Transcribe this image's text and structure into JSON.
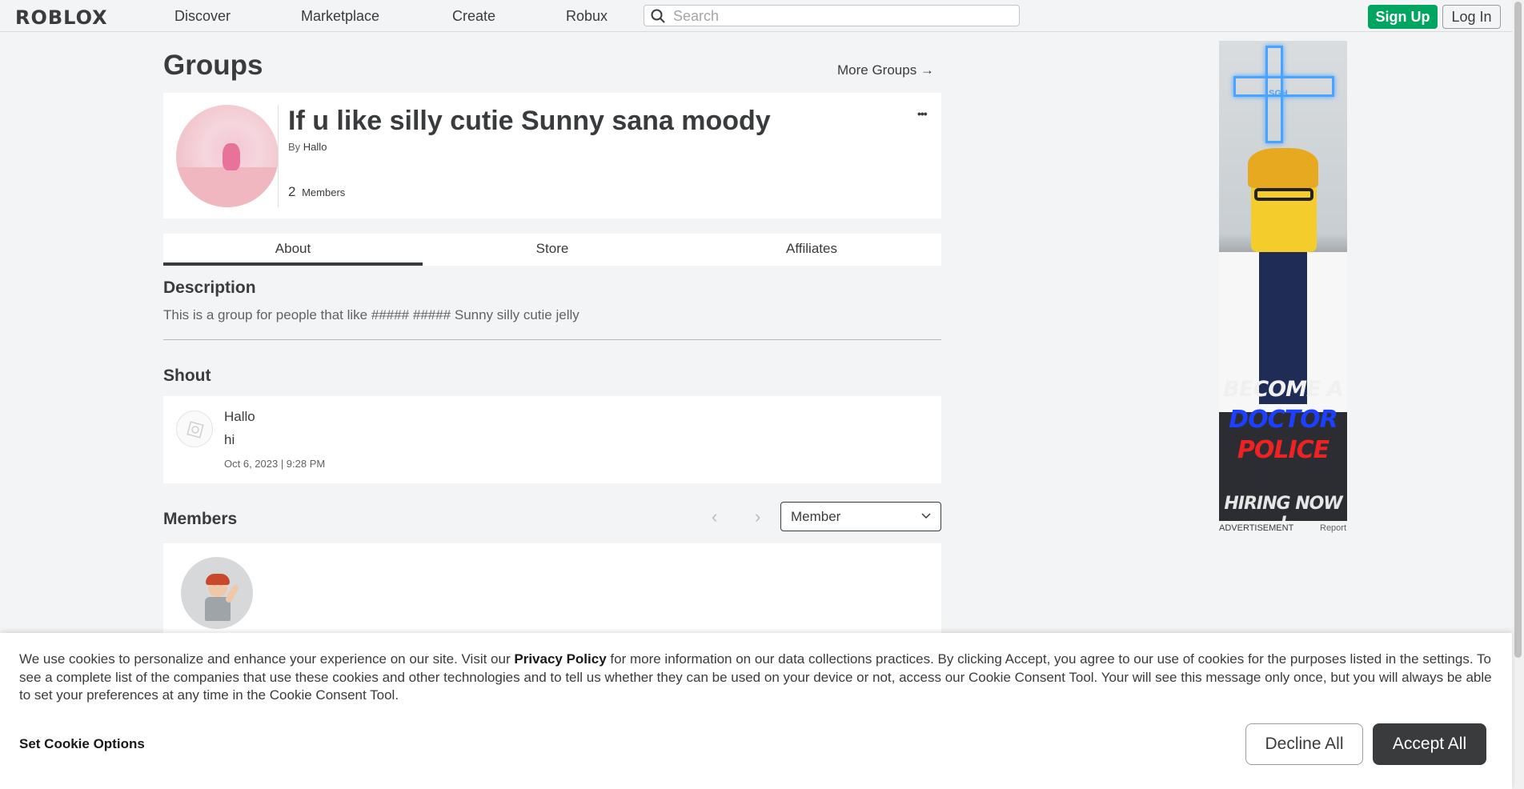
{
  "nav": {
    "logo": "ROBLOX",
    "links": [
      "Discover",
      "Marketplace",
      "Create",
      "Robux"
    ],
    "search_placeholder": "Search",
    "signup_label": "Sign Up",
    "login_label": "Log In"
  },
  "page": {
    "title": "Groups",
    "more_groups": "More Groups →"
  },
  "group": {
    "name": "If u like silly cutie Sunny sana moody",
    "by_prefix": "By",
    "owner": "Hallo",
    "member_count": "2",
    "members_label": "Members",
    "more_icon": "•••"
  },
  "tabs": [
    "About",
    "Store",
    "Affiliates"
  ],
  "active_tab": "About",
  "description": {
    "heading": "Description",
    "text": "This is a group for people that like ##### ##### Sunny silly cutie jelly"
  },
  "shout": {
    "heading": "Shout",
    "user": "Hallo",
    "body": "hi",
    "date": "Oct 6, 2023 | 9:28 PM"
  },
  "members": {
    "heading": "Members",
    "role_selected": "Member",
    "prev_icon": "‹",
    "next_icon": "›"
  },
  "ad": {
    "line1": "BECOME A",
    "line2": "DOCTOR",
    "line3": "POLICE",
    "line4": "HIRING NOW !",
    "cross_text": "SGH",
    "label": "ADVERTISEMENT",
    "report": "Report"
  },
  "cookie": {
    "text_before": "We use cookies to personalize and enhance your experience on our site. Visit our ",
    "link": "Privacy Policy",
    "text_after": " for more information on our data collections practices. By clicking Accept, you agree to our use of cookies for the purposes listed in the settings. To see a complete list of the companies that use these cookies and other technologies and to tell us whether they can be used on your device or not, access our Cookie Consent Tool. Your will see this message only once, but you will always be able to set your preferences at any time in the Cookie Consent Tool.",
    "options_label": "Set Cookie Options",
    "decline_label": "Decline All",
    "accept_label": "Accept All"
  },
  "colors": {
    "background": "#f2f4f5",
    "text": "#393b3d",
    "signup_green": "#00a65f",
    "accept_dark": "#393b3d"
  },
  "icons": {
    "search": "search-icon",
    "more": "more-options-icon",
    "chevron": "chevron-down-icon",
    "prev": "chevron-left-icon",
    "next": "chevron-right-icon"
  }
}
